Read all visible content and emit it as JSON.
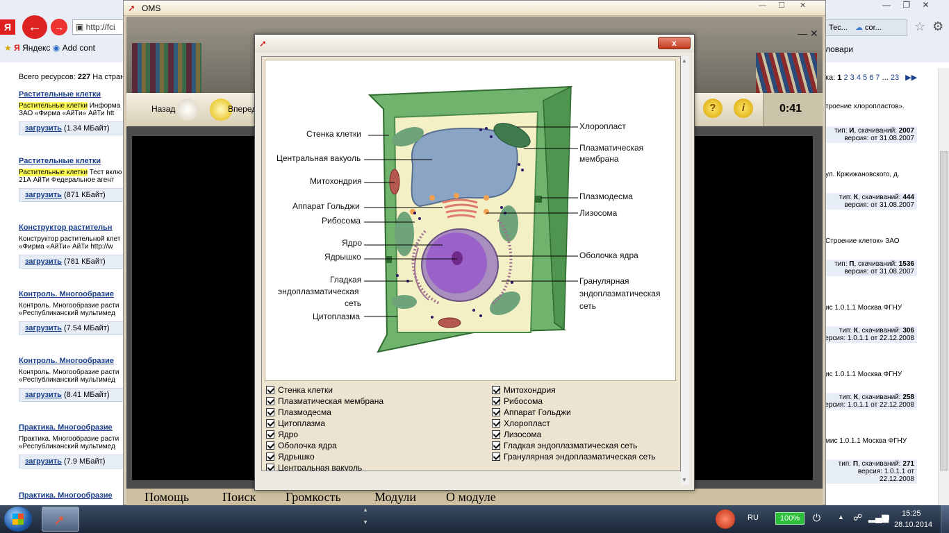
{
  "browser": {
    "address": "http://fci",
    "bookmarks": [
      {
        "label": "Яндекс"
      },
      {
        "label": "Add cont"
      }
    ],
    "right_tabs": [
      "Тес...",
      "cor..."
    ],
    "right_link": "ловари"
  },
  "page": {
    "summary_prefix": "Всего ресурсов:",
    "summary_count": "227",
    "summary_suffix": "На стран",
    "pagination_prefix": "ка:",
    "pages": [
      "1",
      "2",
      "3",
      "4",
      "5",
      "6",
      "7",
      "...",
      "23"
    ],
    "resources": [
      {
        "title": "Растительные клетки",
        "desc1_hl": "Растительные клетки",
        "desc1_rest": " Информа",
        "desc2": "ЗАО «Фирма «АйТи» АйТи htt",
        "download": "загрузить",
        "size": "(1.34 МБайт)",
        "right_desc": "троение хлоропластов».",
        "type_prefix": "тип: ",
        "type": "И",
        "downloads_label": ", скачиваний: ",
        "downloads": "2007",
        "version": "версия: от 31.08.2007"
      },
      {
        "title": "Растительные клетки",
        "desc1_hl": "Растительные клетки",
        "desc1_rest": " Тест вклю",
        "desc2": "21А АйТи Федеральное агент",
        "download": "загрузить",
        "size": "(871 КБайт)",
        "right_desc": "ул. Кржижановского, д.",
        "type_prefix": "тип: ",
        "type": "К",
        "downloads_label": ", скачиваний: ",
        "downloads": "444",
        "version": "версия: от 31.08.2007"
      },
      {
        "title": "Конструктор растительн",
        "desc1_hl": "",
        "desc1_rest": "Конструктор растительной клет",
        "desc2": "«Фирма «АйТи» АйТи http://w",
        "download": "загрузить",
        "size": "(781 КБайт)",
        "right_desc": "Строение клеток» ЗАО",
        "type_prefix": "тип: ",
        "type": "П",
        "downloads_label": ", скачиваний: ",
        "downloads": "1536",
        "version": "версия: от 31.08.2007"
      },
      {
        "title": "Контроль. Многообразие",
        "desc1_hl": "",
        "desc1_rest": "Контроль. Многообразие расти",
        "desc2": "«Республиканский мультимед",
        "download": "загрузить",
        "size": "(7.54 МБайт)",
        "right_desc": "ис 1.0.1.1 Москва ФГНУ",
        "type_prefix": "тип: ",
        "type": "К",
        "downloads_label": ", скачиваний: ",
        "downloads": "306",
        "version": "ерсия: 1.0.1.1 от 22.12.2008"
      },
      {
        "title": "Контроль. Многообразие",
        "desc1_hl": "",
        "desc1_rest": "Контроль. Многообразие расти",
        "desc2": "«Республиканский мультимед",
        "download": "загрузить",
        "size": "(8.41 МБайт)",
        "right_desc": "ис 1.0.1.1 Москва ФГНУ",
        "type_prefix": "тип: ",
        "type": "К",
        "downloads_label": ", скачиваний: ",
        "downloads": "258",
        "version": "ерсия: 1.0.1.1 от 22.12.2008"
      },
      {
        "title": "Практика. Многообразие",
        "desc1_hl": "",
        "desc1_rest": "Практика. Многообразие расти",
        "desc2": "«Республиканский мультимед",
        "download": "загрузить",
        "size": "(7.9 МБайт)",
        "right_desc": "мис 1.0.1.1 Москва ФГНУ",
        "type_prefix": "тип: ",
        "type": "П",
        "downloads_label": ", скачиваний: ",
        "downloads": "271",
        "version": "версия: 1.0.1.1 от 22.12.2008"
      },
      {
        "title": "Практика. Многообразие"
      }
    ]
  },
  "oms": {
    "title": "OMS",
    "back_label": "Назад",
    "forward_label": "Вперед",
    "timer": "0:41",
    "bottom_menu": [
      "Помощь",
      "Поиск",
      "Громкость",
      "Модули",
      "О модуле"
    ]
  },
  "dialog": {
    "close_label": "x",
    "labels_left": [
      "Стенка клетки",
      "Центральная вакуоль",
      "Митохондрия",
      "Аппарат Гольджи",
      "Рибосома",
      "Ядро",
      "Ядрышко",
      "Гладкая",
      "эндоплазматическая",
      "сеть",
      "Цитоплазма"
    ],
    "labels_right": [
      "Хлоропласт",
      "Плазматическая",
      "мембрана",
      "Плазмодесма",
      "Лизосома",
      "Оболочка ядра",
      "Гранулярная",
      "эндоплазматическая",
      "сеть"
    ],
    "checklist_left": [
      "Стенка клетки",
      "Плазматическая мембрана",
      "Плазмодесма",
      "Цитоплазма",
      "Ядро",
      "Оболочка ядра",
      "Ядрышко",
      "Центральная вакуоль"
    ],
    "checklist_right": [
      "Митохондрия",
      "Рибосома",
      "Аппарат Гольджи",
      "Хлоропласт",
      "Лизосома",
      "Гладкая эндоплазматическая сеть",
      "Гранулярная эндоплазматическая сеть"
    ]
  },
  "taskbar": {
    "language": "RU",
    "battery": "100%",
    "time": "15:25",
    "date": "28.10.2014"
  }
}
